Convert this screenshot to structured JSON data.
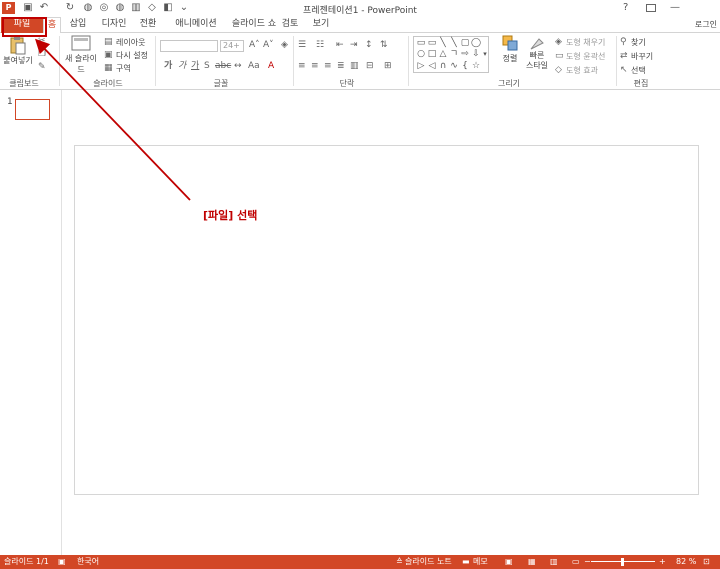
{
  "window": {
    "app_logo": "P",
    "title": "프레젠테이션1 - PowerPoint",
    "help": "?",
    "minimize": "—",
    "close": "✕"
  },
  "qat": {
    "save": "💾",
    "undo": "↶",
    "repeat": "↻",
    "more": "⌄"
  },
  "tabs": {
    "file": "파일",
    "home": "홈",
    "insert": "삽입",
    "design": "디자인",
    "transitions": "전환",
    "animations": "애니메이션",
    "slideshow": "슬라이드 쇼",
    "review": "검토",
    "view": "보기",
    "login": "로그인"
  },
  "ribbon": {
    "clipboard": {
      "paste": "붙여넣기",
      "label": "클립보드"
    },
    "slides": {
      "new_slide": "새 슬라이드",
      "layout": "레이아웃",
      "reset": "다시 설정",
      "section": "구역",
      "label": "슬라이드"
    },
    "font": {
      "size": "24+",
      "label": "글꼴"
    },
    "paragraph": {
      "label": "단락"
    },
    "drawing": {
      "arrange": "정렬",
      "quick_styles": "빠른 스타일",
      "shape_fill": "도형 채우기",
      "shape_outline": "도형 윤곽선",
      "shape_effects": "도형 효과",
      "label": "그리기"
    },
    "editing": {
      "find": "찾기",
      "replace": "바꾸기",
      "select": "선택",
      "label": "편집"
    }
  },
  "thumbnails": {
    "slide_number": "1"
  },
  "annotation": {
    "text": "[파일] 선택",
    "color": "#c00000"
  },
  "statusbar": {
    "slide_info": "슬라이드 1/1",
    "language": "한국어",
    "notes": "슬라이드 노트",
    "comments": "메모",
    "zoom": "82 %",
    "zoom_minus": "−",
    "zoom_plus": "+"
  },
  "colors": {
    "accent": "#d24726",
    "annotation": "#c00000"
  }
}
